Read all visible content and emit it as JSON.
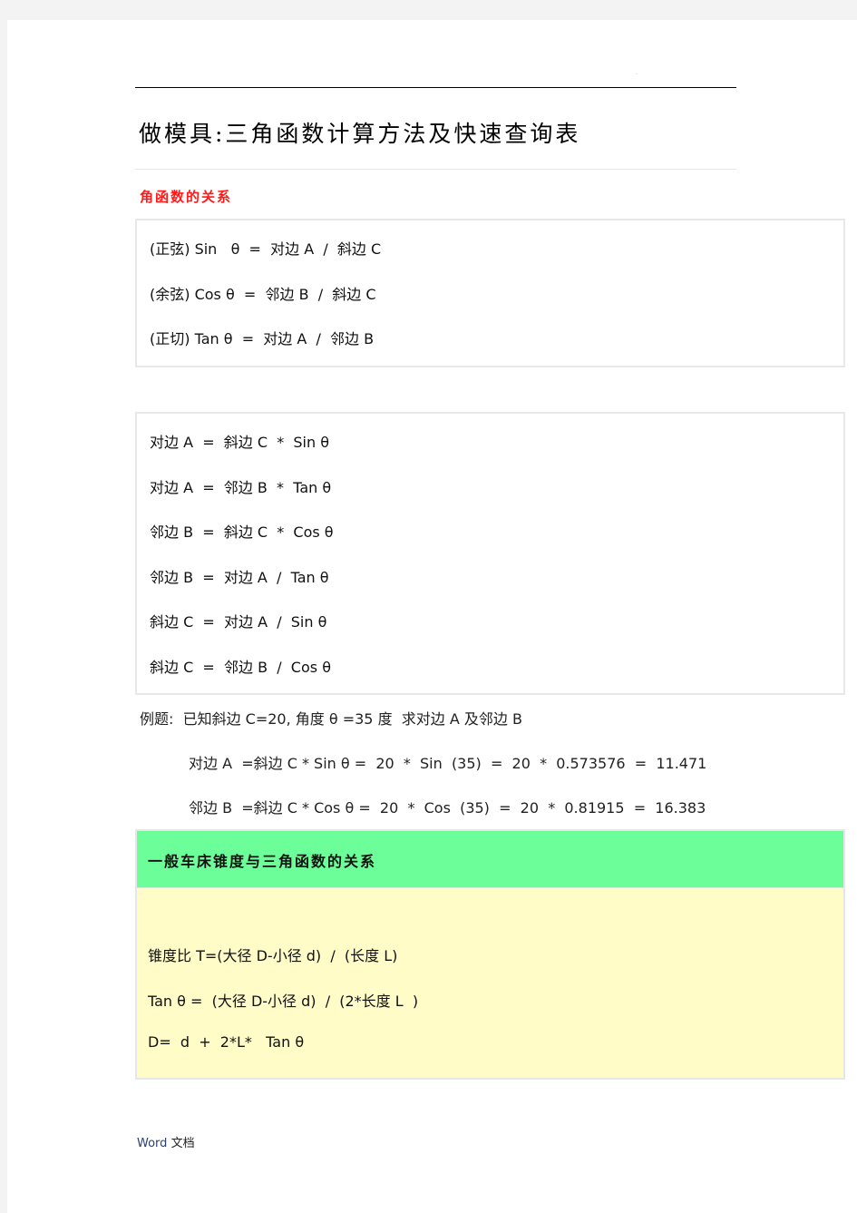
{
  "header": {
    "mark": "."
  },
  "title": "做模具:三角函数计算方法及快速查询表",
  "section1": {
    "heading": "角函数的关系",
    "definitions": [
      "(正弦) Sin   θ  =  对边 A  /  斜边 C",
      "(余弦) Cos θ  =  邻边 B  /  斜边 C",
      "(正切) Tan θ  =  对边 A  /  邻边 B"
    ],
    "derived": [
      "对边 A  =  斜边 C  *  Sin θ",
      "对边 A  =  邻边 B  *  Tan θ",
      "邻边 B  =  斜边 C  *  Cos θ",
      "邻边 B  =  对边 A  /  Tan θ",
      "斜边 C  =  对边 A  /  Sin θ",
      "斜边 C  =  邻边 B  /  Cos θ"
    ]
  },
  "example": {
    "label": "例题:  已知斜边 C=20, 角度 θ =35 度  求对边 A 及邻边 B",
    "line_a": "对边 A  =斜边 C * Sin θ =  20  *  Sin  (35)  =  20  *  0.573576  =  11.471",
    "line_b": "邻边 B  =斜边 C * Cos θ =  20  *  Cos  (35)  =  20  *  0.81915  =  16.383"
  },
  "taper": {
    "title": "一般车床锥度与三角函数的关系",
    "lines": [
      "锥度比 T=(大径 D-小径 d)  /  (长度 L)",
      "Tan θ =  (大径 D-小径 d)  /  (2*长度 L  )",
      "D=  d  +  2*L*   Tan θ"
    ],
    "colors": {
      "header_bg": "#6cff99",
      "body_bg": "#fffcc8"
    }
  },
  "footer": {
    "word": "Word",
    "doc": "文档"
  },
  "colors": {
    "section_heading": "#ff1a1a"
  }
}
